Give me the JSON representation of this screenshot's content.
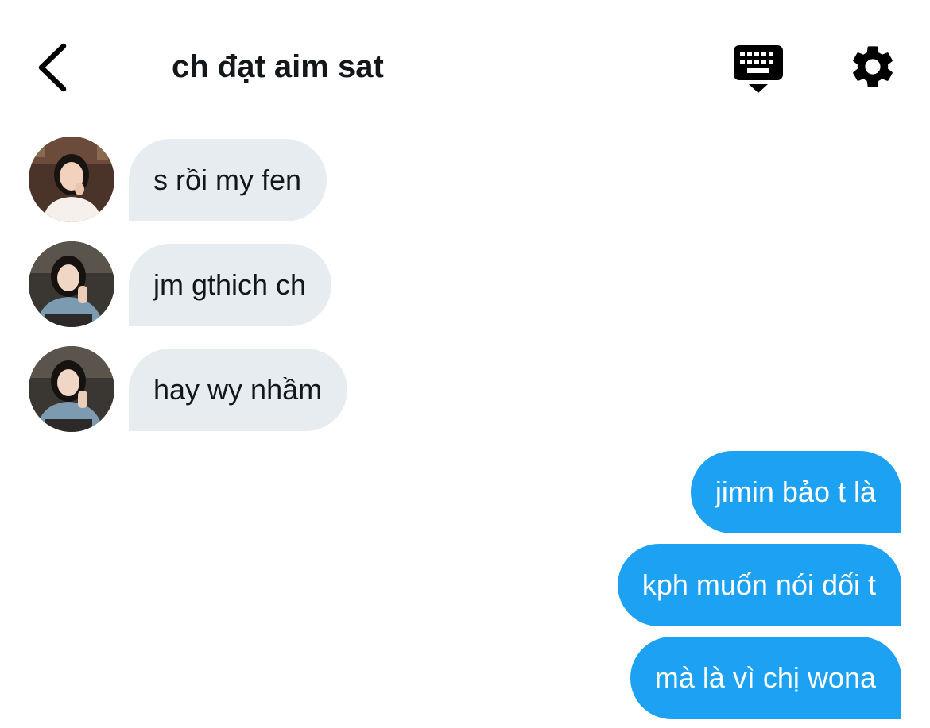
{
  "header": {
    "title": "ch đạt aim sat",
    "back_icon": "chevron-left-icon",
    "keyboard_icon": "keyboard-hide-icon",
    "settings_icon": "gear-icon"
  },
  "messages": [
    {
      "direction": "incoming",
      "text": "s rồi my fen"
    },
    {
      "direction": "incoming",
      "text": "jm gthich ch"
    },
    {
      "direction": "incoming",
      "text": "hay wy nhầm"
    },
    {
      "direction": "outgoing",
      "text": "jimin bảo t là"
    },
    {
      "direction": "outgoing",
      "text": "kph muốn nói dối t"
    },
    {
      "direction": "outgoing",
      "text": "mà là vì chị wona"
    }
  ],
  "colors": {
    "incoming_bubble": "#e6ecf0",
    "outgoing_bubble": "#1da1f2",
    "text_dark": "#14171a",
    "text_light": "#ffffff"
  }
}
